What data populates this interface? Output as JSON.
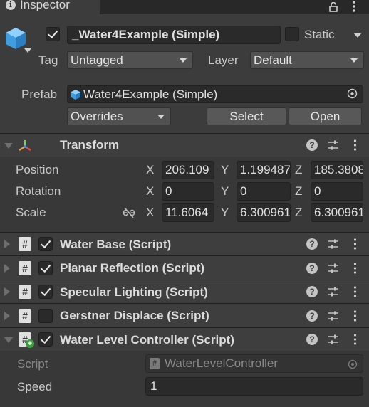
{
  "window": {
    "tab_title": "Inspector",
    "tab_icon": "info-icon",
    "lock_icon": "lock-icon",
    "menu_icon": "kebab-menu-icon"
  },
  "object": {
    "active": true,
    "name": "_Water4Example (Simple)",
    "static_label": "Static",
    "static_checked": false,
    "tag_label": "Tag",
    "tag_value": "Untagged",
    "layer_label": "Layer",
    "layer_value": "Default"
  },
  "prefab": {
    "label": "Prefab",
    "asset": "Water4Example (Simple)",
    "overrides_label": "Overrides",
    "select_label": "Select",
    "open_label": "Open"
  },
  "transform": {
    "title": "Transform",
    "expanded": true,
    "rows": [
      {
        "label": "Position",
        "x": "206.109",
        "y": "1.199487",
        "z": "185.3808"
      },
      {
        "label": "Rotation",
        "x": "0",
        "y": "0",
        "z": "0"
      },
      {
        "label": "Scale",
        "x": "11.6064",
        "y": "6.300961",
        "z": "6.300961"
      }
    ],
    "axis_x": "X",
    "axis_y": "Y",
    "axis_z": "Z"
  },
  "components": [
    {
      "title": "Water Base (Script)",
      "enabled": true,
      "expanded": false
    },
    {
      "title": "Planar Reflection (Script)",
      "enabled": true,
      "expanded": false
    },
    {
      "title": "Specular Lighting (Script)",
      "enabled": true,
      "expanded": false
    },
    {
      "title": "Gerstner Displace (Script)",
      "enabled": false,
      "expanded": false
    },
    {
      "title": "Water Level Controller (Script)",
      "enabled": true,
      "expanded": true
    }
  ],
  "water_level_controller": {
    "script_label": "Script",
    "script_value": "WaterLevelController",
    "speed_label": "Speed",
    "speed_value": "1"
  },
  "colors": {
    "background": "#383838",
    "header": "#3c3c3c",
    "field": "#2a2a2a",
    "accent_cube": "#4aa8e8"
  }
}
